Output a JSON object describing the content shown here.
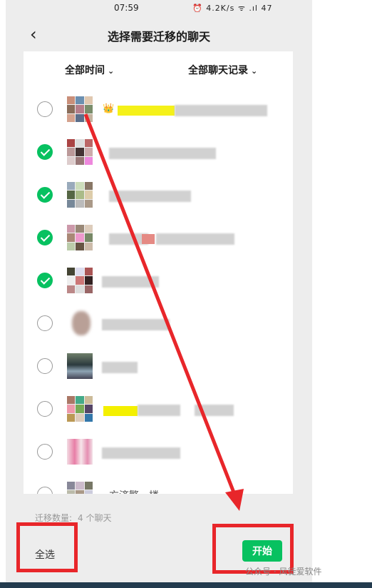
{
  "status": {
    "time": "07:59",
    "icons_text": "⏰ 4.2K/s ᯤ .ıl 47"
  },
  "nav": {
    "title": "选择需要迁移的聊天"
  },
  "filters": {
    "time": "全部时间",
    "records": "全部聊天记录"
  },
  "chats": [
    {
      "checked": false,
      "name_partial": "👑"
    },
    {
      "checked": true
    },
    {
      "checked": true
    },
    {
      "checked": true
    },
    {
      "checked": true
    },
    {
      "checked": false
    },
    {
      "checked": false
    },
    {
      "checked": false
    },
    {
      "checked": false
    },
    {
      "checked": false,
      "name_partial": "方济繁一楼"
    }
  ],
  "footer": {
    "count_label": "迁移数量:",
    "count_value": "4 个聊天",
    "select_all": "全选",
    "start": "开始"
  },
  "watermark": "公众号 · 风徒爱软件",
  "colors": {
    "accent": "#07c160",
    "highlight": "#e8262a"
  }
}
